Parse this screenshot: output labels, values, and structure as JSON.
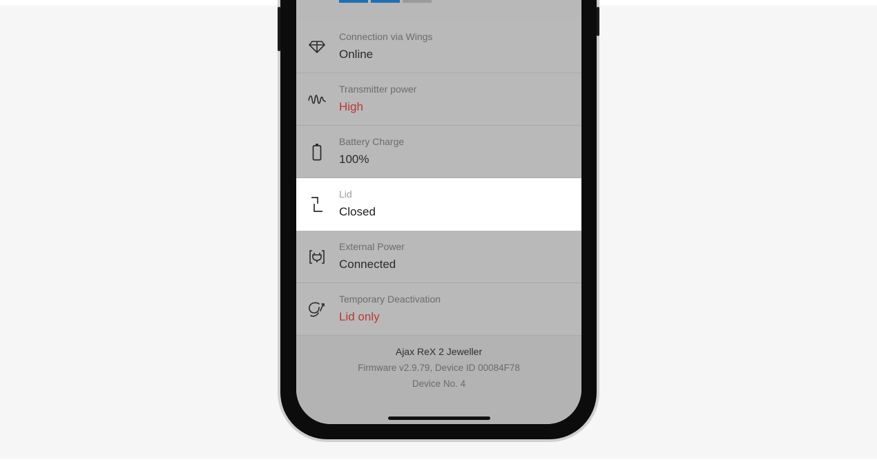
{
  "colors": {
    "page_background": "#f6f6f6",
    "screen_background": "#b9b9b9",
    "highlight_row": "#ffffff",
    "warning_value": "#b83a32",
    "accent_strip": "#1e6fb4"
  },
  "settings": {
    "items": [
      {
        "icon": "wings-diamond-icon",
        "label": "Connection via Wings",
        "value": "Online",
        "highlighted": false,
        "warning": false
      },
      {
        "icon": "signal-wave-icon",
        "label": "Transmitter power",
        "value": "High",
        "highlighted": false,
        "warning": true
      },
      {
        "icon": "battery-icon",
        "label": "Battery Charge",
        "value": "100%",
        "highlighted": false,
        "warning": false
      },
      {
        "icon": "lid-icon",
        "label": "Lid",
        "value": "Closed",
        "highlighted": true,
        "warning": false
      },
      {
        "icon": "external-power-icon",
        "label": "External Power",
        "value": "Connected",
        "highlighted": false,
        "warning": false
      },
      {
        "icon": "temporary-deactivation-icon",
        "label": "Temporary Deactivation",
        "value": "Lid only",
        "highlighted": false,
        "warning": true
      }
    ]
  },
  "device": {
    "name": "Ajax ReX 2 Jeweller",
    "firmware_line": "Firmware v2.9.79, Device ID 00084F78",
    "number_line": "Device No. 4"
  }
}
